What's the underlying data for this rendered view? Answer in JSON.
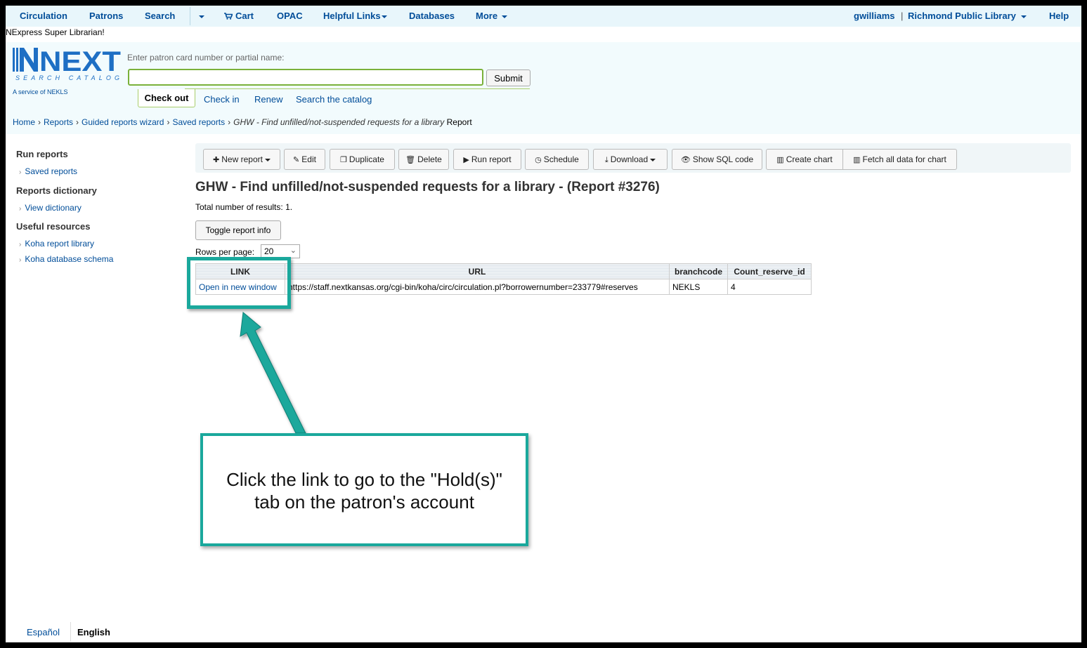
{
  "nav": {
    "circulation": "Circulation",
    "patrons": "Patrons",
    "search": "Search",
    "cart": "Cart",
    "opac": "OPAC",
    "helpful_links": "Helpful Links",
    "databases": "Databases",
    "more": "More",
    "user": "gwilliams",
    "separator": "|",
    "library": "Richmond Public Library",
    "help": "Help"
  },
  "greeting": "NExpress Super Librarian!",
  "logo": {
    "main": "NEXT",
    "tagline": "SEARCH CATALOG",
    "subtitle": "A service of NEKLS"
  },
  "checkout": {
    "label": "Enter patron card number or partial name:",
    "input_value": "",
    "submit": "Submit",
    "tabs": [
      "Check out",
      "Check in",
      "Renew",
      "Search the catalog"
    ]
  },
  "breadcrumb": {
    "items": [
      "Home",
      "Reports",
      "Guided reports wizard",
      "Saved reports"
    ],
    "current_italic": "GHW - Find unfilled/not-suspended requests for a library",
    "current_suffix": "Report"
  },
  "sidebar": {
    "sections": [
      {
        "heading": "Run reports",
        "links": [
          "Saved reports"
        ]
      },
      {
        "heading": "Reports dictionary",
        "links": [
          "View dictionary"
        ]
      },
      {
        "heading": "Useful resources",
        "links": [
          "Koha report library",
          "Koha database schema"
        ]
      }
    ]
  },
  "toolbar": {
    "new_report": "New report",
    "edit": "Edit",
    "duplicate": "Duplicate",
    "delete": "Delete",
    "run_report": "Run report",
    "schedule": "Schedule",
    "download": "Download",
    "show_sql": "Show SQL code",
    "create_chart": "Create chart",
    "fetch_all": "Fetch all data for chart"
  },
  "report": {
    "title": "GHW - Find unfilled/not-suspended requests for a library - (Report #3276)",
    "total_label": "Total number of results:",
    "total_value": "1.",
    "toggle_info": "Toggle report info",
    "rows_per_page_label": "Rows per page:",
    "rows_per_page_value": "20",
    "columns": [
      "LINK",
      "URL",
      "branchcode",
      "Count_reserve_id"
    ],
    "rows": [
      [
        "Open in new window",
        "https://staff.nextkansas.org/cgi-bin/koha/circ/circulation.pl?borrowernumber=233779#reserves",
        "NEKLS",
        "4"
      ]
    ]
  },
  "annotation": {
    "line1": "Click the link to go to the \"Hold(s)\"",
    "line2": "tab on the patron's account",
    "color": "#1aa89c"
  },
  "languages": [
    "Español",
    "English"
  ],
  "colors": {
    "link": "#004d99",
    "nav_bg": "#e8f6fb",
    "header_bg": "#f2fbfd",
    "tab_border": "#a9cd6a"
  }
}
